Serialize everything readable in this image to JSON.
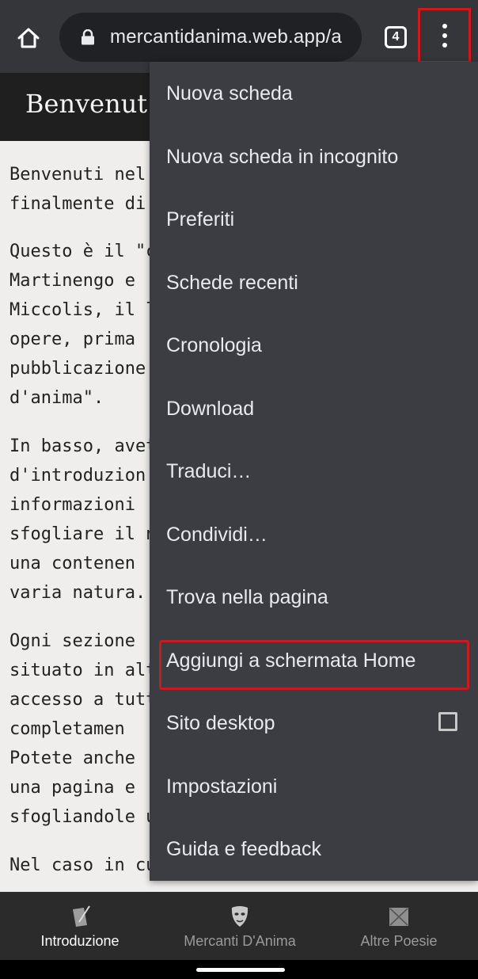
{
  "browser": {
    "url": "mercantidanima.web.app/a",
    "tab_count": "4"
  },
  "page": {
    "title": "Benvenut",
    "paragraphs": [
      "Benvenuti nel\nfinalmente di",
      "Questo è il \"co\nMartinengo e\nMiccolis, il lu\nopere, prima\npubblicazione\nd'anima\".",
      "In basso, avet\nd'introduzion\ninformazioni\nsfogliare il no\nuna contenen\nvaria natura.",
      "Ogni sezione\nsituato in alto\naccesso a tutt\ncompletamen\nPotete anche\nuna pagina e\nsfogliandole u",
      "Nel caso in cu"
    ]
  },
  "menu": {
    "items": [
      {
        "label": "Nuova scheda"
      },
      {
        "label": "Nuova scheda in incognito"
      },
      {
        "label": "Preferiti"
      },
      {
        "label": "Schede recenti"
      },
      {
        "label": "Cronologia"
      },
      {
        "label": "Download"
      },
      {
        "label": "Traduci…"
      },
      {
        "label": "Condividi…"
      },
      {
        "label": "Trova nella pagina"
      },
      {
        "label": "Aggiungi a schermata Home"
      },
      {
        "label": "Sito desktop",
        "checkbox_checked": false
      },
      {
        "label": "Impostazioni"
      },
      {
        "label": "Guida e feedback"
      }
    ]
  },
  "bottom_nav": {
    "items": [
      {
        "label": "Introduzione",
        "icon": "quill-paper-icon",
        "active": true
      },
      {
        "label": "Mercanti D'Anima",
        "icon": "theater-mask-icon",
        "active": false
      },
      {
        "label": "Altre Poesie",
        "icon": "book-icon",
        "active": false
      }
    ]
  },
  "colors": {
    "toolbar": "#35363a",
    "menu_bg": "#3c3d42",
    "highlight_red": "#c61b22",
    "page_bg": "#efeeec"
  }
}
